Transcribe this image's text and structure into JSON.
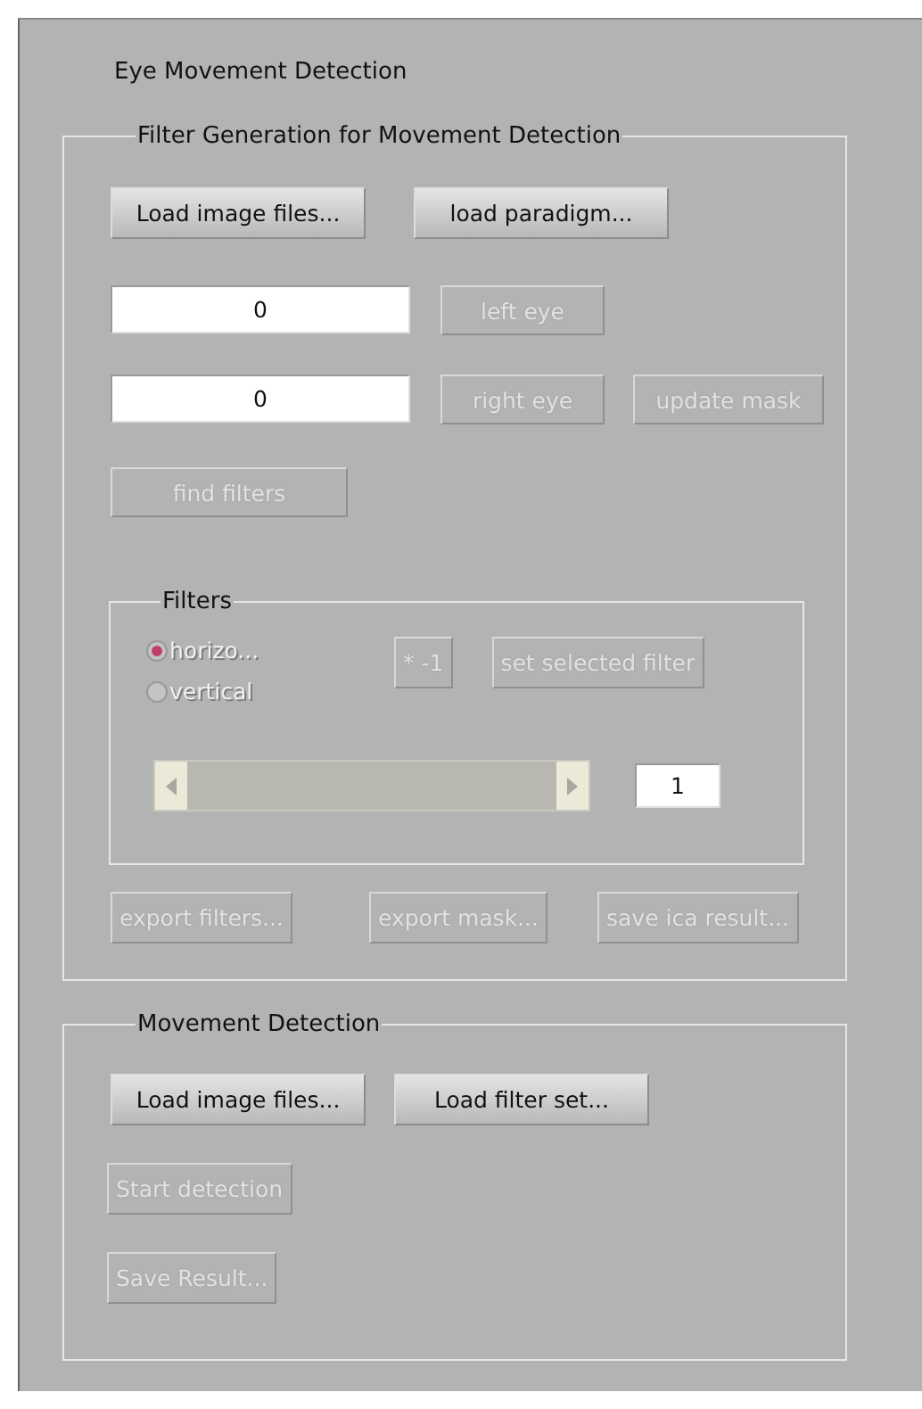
{
  "title": "Eye Movement Detection",
  "filter_generation": {
    "title": "Filter Generation for Movement Detection",
    "load_buttons": [
      {
        "label": "Load image files...",
        "disabled": false
      },
      {
        "label": "load paradigm...",
        "disabled": false
      }
    ],
    "left_eye": {
      "value": "0",
      "button": {
        "label": "left eye",
        "disabled": true
      }
    },
    "right_eye": {
      "value": "0",
      "button": {
        "label": "right eye",
        "disabled": true
      }
    },
    "update_mask_button": {
      "label": "update mask",
      "disabled": true
    },
    "find_filters_button": {
      "label": "find filters",
      "disabled": true
    },
    "filters": {
      "title": "Filters",
      "radios": [
        {
          "label": "horizo...",
          "selected": true,
          "disabled": true
        },
        {
          "label": "vertical",
          "selected": false,
          "disabled": true
        }
      ],
      "invert_button": {
        "label": "* -1",
        "disabled": true
      },
      "set_button": {
        "label": "set selected filter",
        "disabled": true
      },
      "slider": {
        "disabled": true
      },
      "value": "1"
    },
    "export_buttons": [
      {
        "label": "export filters...",
        "disabled": true
      },
      {
        "label": "export mask...",
        "disabled": true
      },
      {
        "label": "save ica result...",
        "disabled": true
      }
    ]
  },
  "movement_detection": {
    "title": "Movement Detection",
    "load_buttons": [
      {
        "label": "Load image files...",
        "disabled": false
      },
      {
        "label": "Load filter set...",
        "disabled": false
      }
    ],
    "start_button": {
      "label": "Start detection",
      "disabled": true
    },
    "save_button": {
      "label": "Save Result...",
      "disabled": true
    }
  }
}
